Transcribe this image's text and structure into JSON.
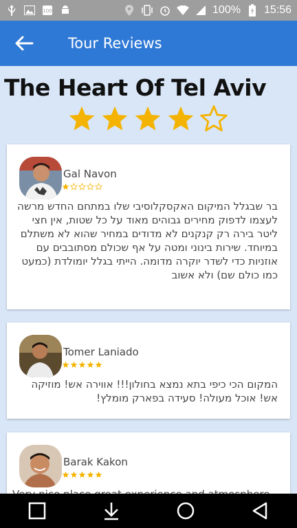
{
  "status_bar": {
    "battery": "100%",
    "time": "15:56",
    "icons_left": [
      "usb-icon",
      "image-icon",
      "battery-100-icon",
      "android-icon"
    ],
    "icons_right": [
      "location-icon",
      "vibrate-icon",
      "alarm-icon",
      "wifi-icon",
      "signal-icon",
      "battery-charging-icon"
    ]
  },
  "app_bar": {
    "title": "Tour Reviews",
    "back_icon": "arrow-left-icon",
    "background": "#2f79d6"
  },
  "tour": {
    "name": "The Heart Of Tel Aviv",
    "rating": 4,
    "max_rating": 5,
    "star_color": "#f5b301"
  },
  "reviews": [
    {
      "reviewer": "Gal Navon",
      "rating": 1,
      "text": "בר שבגלל המיקום האקסקלוסיבי שלו במתחם החדש מרשה לעצמו לדפוק מחירים גבוהים מאוד על כל שטות, אין חצי ליטר בירה רק קנקנים לא מדודים במחיר שהוא לא משתלם במיוחד. שירות בינוני ומטה על אף שכולם מסתובבים עם אוזניות כדי לשדר יוקרה מדומה. הייתי בגלל יומולדת (כמעט כמו כולם שם) ולא אשוב"
    },
    {
      "reviewer": "Tomer Laniado",
      "rating": 5,
      "text": "המקום הכי כיפי בתא נמצא בחולון!!! אווירה אש! מוזיקה אש! אוכל מעולה! סעידה בפארק מומלץ!"
    },
    {
      "reviewer": "Barak Kakon",
      "rating": 5,
      "text": "Very nice place great experience and atmosphere"
    }
  ],
  "nav_bar": {
    "buttons": [
      "square-icon",
      "download-icon",
      "circle-icon",
      "triangle-back-icon"
    ]
  }
}
